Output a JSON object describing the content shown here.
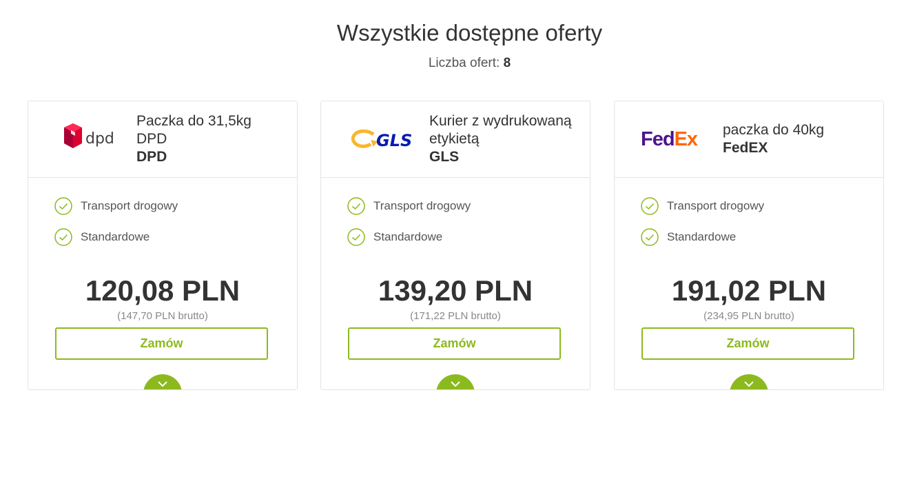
{
  "header": {
    "title": "Wszystkie dostępne oferty",
    "count_label": "Liczba ofert:",
    "count_value": "8"
  },
  "offers": [
    {
      "logo": "dpd-logo",
      "line1": "Paczka do 31,5kg",
      "line2": "DPD",
      "carrier": "DPD",
      "features": [
        "Transport drogowy",
        "Standardowe"
      ],
      "price": "120,08 PLN",
      "gross": "(147,70 PLN brutto)",
      "button": "Zamów"
    },
    {
      "logo": "gls-logo",
      "line1": "Kurier z wydrukowaną etykietą",
      "line2": "",
      "carrier": "GLS",
      "features": [
        "Transport drogowy",
        "Standardowe"
      ],
      "price": "139,20 PLN",
      "gross": "(171,22 PLN brutto)",
      "button": "Zamów"
    },
    {
      "logo": "fedex-logo",
      "line1": "paczka do 40kg",
      "line2": "",
      "carrier": "FedEX",
      "features": [
        "Transport drogowy",
        "Standardowe"
      ],
      "price": "191,02 PLN",
      "gross": "(234,95 PLN brutto)",
      "button": "Zamów"
    }
  ],
  "colors": {
    "accent": "#8cb91e",
    "dpd_red": "#dc0032",
    "fedex_purple": "#4d148c",
    "fedex_orange": "#ff6600",
    "gls_blue": "#061ab1",
    "gls_yellow": "#f8b72b"
  },
  "logos": {
    "dpd_text": "dpd",
    "gls_text": "GLS",
    "fedex_fed": "Fed",
    "fedex_ex": "Ex"
  }
}
